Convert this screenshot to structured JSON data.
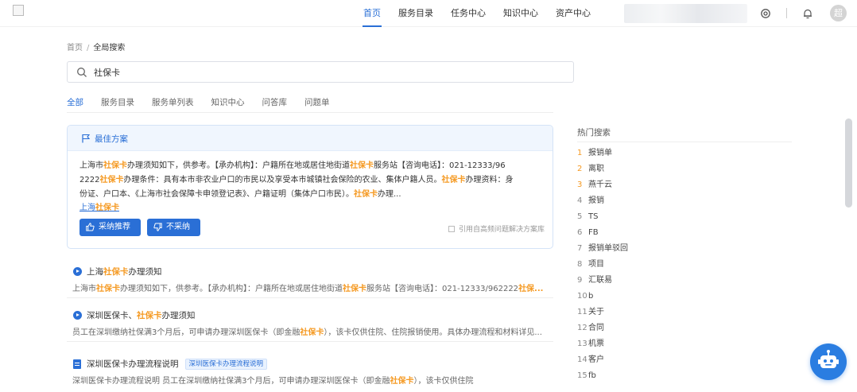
{
  "topnav": {
    "items": [
      {
        "label": "首页",
        "active": true
      },
      {
        "label": "服务目录",
        "active": false
      },
      {
        "label": "任务中心",
        "active": false
      },
      {
        "label": "知识中心",
        "active": false
      },
      {
        "label": "资产中心",
        "active": false
      }
    ],
    "avatar_text": "超",
    "icons": [
      "settings-icon",
      "bell-icon"
    ]
  },
  "breadcrumb": {
    "home": "首页",
    "sep": "/",
    "current": "全局搜索"
  },
  "search": {
    "value": "社保卡",
    "icon": "search-icon"
  },
  "tabs": [
    {
      "label": "全部",
      "active": true
    },
    {
      "label": "服务目录",
      "active": false
    },
    {
      "label": "服务单列表",
      "active": false
    },
    {
      "label": "知识中心",
      "active": false
    },
    {
      "label": "问答库",
      "active": false
    },
    {
      "label": "问题单",
      "active": false
    }
  ],
  "best": {
    "title": "最佳方案",
    "lines": [
      [
        "上海市",
        "社保卡",
        "办理须知如下，供参考。【承办机构】：户籍所在地或居住地街道",
        "社保卡",
        "服务站【咨询电话】：021-12333/96"
      ],
      [
        "2222",
        "社保卡",
        "办理条件：具有本市非农业户口的市民以及享受本市城镇社会保险的农业、集体户籍人员。",
        "社保卡",
        "办理资料：身"
      ],
      [
        "份证、户口本、《上海市社会保障卡申领登记表》、户籍证明（集体户口市民）。",
        "社保卡",
        "办理..."
      ]
    ],
    "link_pre": "上海",
    "link_hl": "社保卡",
    "adopt_label": "采纳推荐",
    "reject_label": "不采纳",
    "cite_label": "引用自高频问题解决方案库"
  },
  "results": [
    {
      "icon": "play-icon",
      "title_pre": "上海",
      "title_hl": "社保卡",
      "title_post": "办理须知",
      "tag": "",
      "desc": [
        "上海市",
        "社保卡",
        "办理须知如下，供参考。【承办机构】：户籍所在地或居住地街道",
        "社保卡",
        "服务站【咨询电话】：021-12333/962222",
        "社保..."
      ]
    },
    {
      "icon": "play-icon",
      "title_pre": "深圳医保卡、",
      "title_hl": "社保卡",
      "title_post": "办理须知",
      "tag": "",
      "desc": [
        "员工在深圳缴纳社保满3个月后，可申请办理深圳医保卡（即金融",
        "社保卡",
        "），该卡仅供住院、住院报销使用。具体办理流程和材料详见...",
        "",
        "",
        ""
      ]
    },
    {
      "icon": "document-icon",
      "title_pre": "深圳医保卡办理流程说明",
      "title_hl": "",
      "title_post": "",
      "tag": "深圳医保卡办理流程说明",
      "desc": [
        "深圳医保卡办理流程说明 员工在深圳缴纳社保满3个月后，可申请办理深圳医保卡（即金融",
        "社保卡",
        "），该卡仅供住院",
        "",
        "",
        ""
      ]
    }
  ],
  "hot": {
    "title": "热门搜索",
    "items": [
      {
        "rank": "1",
        "label": "报销单"
      },
      {
        "rank": "2",
        "label": "离职"
      },
      {
        "rank": "3",
        "label": "燕千云"
      },
      {
        "rank": "4",
        "label": "报销"
      },
      {
        "rank": "5",
        "label": "TS"
      },
      {
        "rank": "6",
        "label": "FB"
      },
      {
        "rank": "7",
        "label": "报销单驳回"
      },
      {
        "rank": "8",
        "label": "项目"
      },
      {
        "rank": "9",
        "label": "汇联易"
      },
      {
        "rank": "10",
        "label": "b"
      },
      {
        "rank": "11",
        "label": "关于"
      },
      {
        "rank": "12",
        "label": "合同"
      },
      {
        "rank": "13",
        "label": "机票"
      },
      {
        "rank": "14",
        "label": "客户"
      },
      {
        "rank": "15",
        "label": "fb"
      }
    ]
  },
  "colors": {
    "accent": "#2a6fd6",
    "highlight": "#f59a23"
  }
}
